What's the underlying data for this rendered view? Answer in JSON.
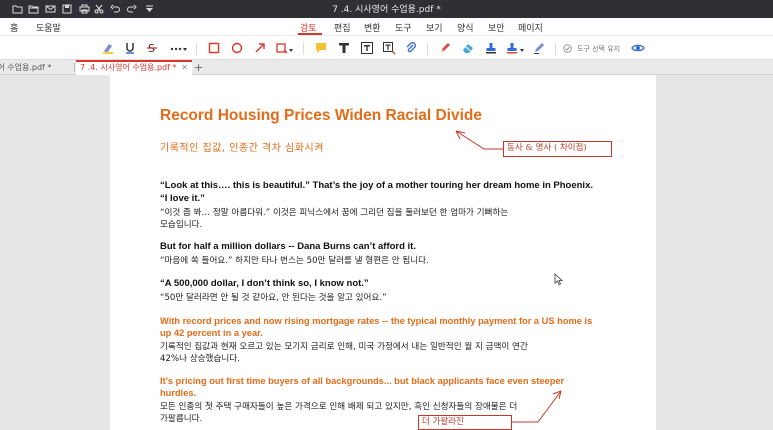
{
  "app": {
    "window_title": "7 .4. 시사영어 수업용.pdf *"
  },
  "menu": {
    "left": [
      "홈",
      "도움말"
    ],
    "tabs": [
      "검토",
      "편집",
      "변환",
      "도구",
      "보기",
      "양식",
      "보안",
      "페이지"
    ],
    "active_tab": "검토"
  },
  "toolbar": {
    "right_label": "도구 선택 유지"
  },
  "tabs": [
    {
      "label": "영어 수업용.pdf *",
      "active": false
    },
    {
      "label": "7 .4. 시사영어 수업용.pdf *",
      "active": true
    }
  ],
  "document": {
    "title": "Record Housing Prices Widen Racial Divide",
    "subtitle": "기록적인 집값, 인종간 격차 심화시켜",
    "paragraphs": [
      {
        "en1": "“Look at this…. this is beautiful.” That’s the joy of a mother touring her dream home in Phoenix.",
        "en2": "“I love it.”",
        "ko1": "“이것 좀 봐… 정말 아름다워.” 이것은 피닉스에서 꿈에 그리던 집을 둘러보던 한 엄마가 기뻐하는",
        "ko2": "모습입니다."
      },
      {
        "en1": " But for half a million dollars -- Dana Burns can’t afford it.",
        "ko1": "“마음에 쏙 들어요.” 하지만 타나 번스는 50만 달러를 낼 형편은 안 됩니다."
      },
      {
        "en1": "“A 500,000 dollar, I don’t think so, I know not.”",
        "ko1": "“50만 달러라면 안 될 것 같아요, 안 된다는 것을 알고 있어요.”"
      },
      {
        "en1": "With record prices and now rising mortgage rates -- the typical monthly payment for a US home is",
        "en2": "up 42 percent in a year.",
        "ko1": "기록적인 집값과 현재 오르고 있는 모기지 금리로 인해, 미국 가정에서 내는 일반적인 월 지 금액이 연간",
        "ko2": "42%나 상승했습니다."
      },
      {
        "en1": "It’s pricing out first time buyers of all backgrounds... but black applicants face even steeper",
        "en2": "hurdles.",
        "ko1": "모든 인종의 첫 주택 구매자들이 높은 가격으로 인해 배제 되고 있지만, 흑인 신청자들의 장애물은 더",
        "ko2": "가팔릅니다."
      }
    ]
  },
  "annotations": [
    {
      "text": "동사 & 명사 ( 차이점)"
    },
    {
      "text": "더 가팔라진"
    }
  ],
  "colors": {
    "accent": "#d9362b",
    "heading_orange": "#e36c1a",
    "annotation_red": "#c0392b"
  }
}
